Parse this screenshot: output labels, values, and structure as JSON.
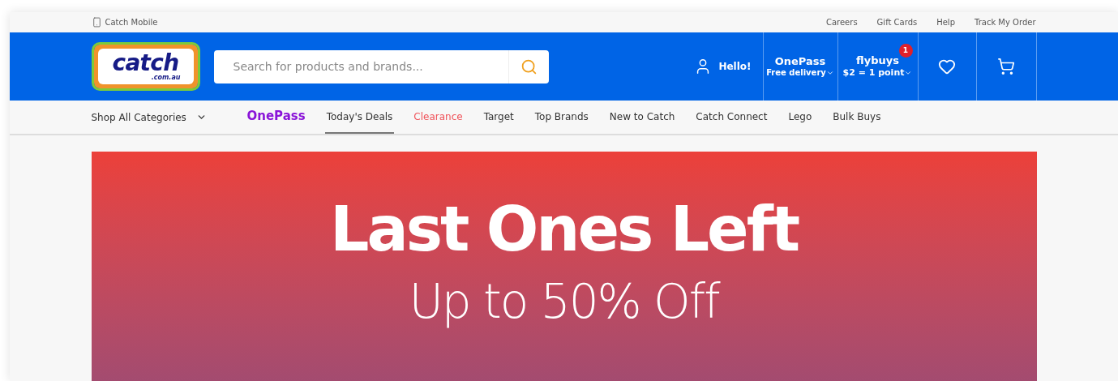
{
  "top_bar": {
    "mobile_link": "Catch Mobile",
    "links": [
      "Careers",
      "Gift Cards",
      "Help",
      "Track My Order"
    ]
  },
  "header": {
    "logo": {
      "name": "catch",
      "domain": ".com.au"
    },
    "search": {
      "placeholder": "Search for products and brands..."
    },
    "account": "Hello!",
    "onepass": {
      "title": "OnePass",
      "subtitle": "Free delivery"
    },
    "flybuys": {
      "title": "flybuys",
      "subtitle": "$2 = 1 point",
      "badge": "1"
    }
  },
  "nav": {
    "categories": "Shop All Categories",
    "items": [
      {
        "label": "OnePass",
        "kind": "brand",
        "selected": false
      },
      {
        "label": "Today's Deals",
        "kind": "link",
        "selected": true
      },
      {
        "label": "Clearance",
        "kind": "sale",
        "selected": false
      },
      {
        "label": "Target",
        "kind": "link",
        "selected": false
      },
      {
        "label": "Top Brands",
        "kind": "link",
        "selected": false
      },
      {
        "label": "New to Catch",
        "kind": "link",
        "selected": false
      },
      {
        "label": "Catch Connect",
        "kind": "link",
        "selected": false
      },
      {
        "label": "Lego",
        "kind": "link",
        "selected": false
      },
      {
        "label": "Bulk Buys",
        "kind": "link",
        "selected": false
      }
    ]
  },
  "banner": {
    "title": "Last Ones Left",
    "subtitle": "Up to 50% Off"
  }
}
